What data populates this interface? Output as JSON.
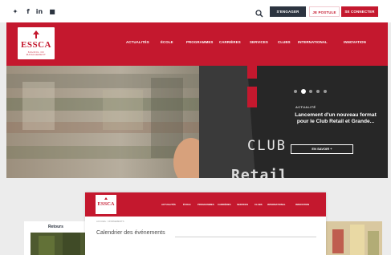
{
  "social": {
    "icons": [
      "twitter-icon",
      "facebook-icon",
      "linkedin-icon",
      "youtube-icon"
    ],
    "glyphs": [
      "🐦",
      "f",
      "in",
      "▶"
    ]
  },
  "utility": {
    "espaces_label": "S'ENGAGER",
    "apply_label": "JE POSTULE",
    "login_label": "SE CONNECTER",
    "search_icon": "search-icon"
  },
  "brand": {
    "logo_text": "ESSCA",
    "logo_subtitle": "SCHOOL OF MANAGEMENT"
  },
  "nav": {
    "items": [
      "ACTUALITÉS",
      "ÉCOLE",
      "PROGRAMMES",
      "CARRIÈRES",
      "SERVICES",
      "CLUBS",
      "INTERNATIONAL",
      "INNOVATION"
    ]
  },
  "hero": {
    "kicker": "ACTUALITÉ",
    "headline": "Lancement d'un nouveau format pour le Club Retail et Grande...",
    "cta": "EN SAVOIR +",
    "sign_text": "CLUB",
    "sign_text2": "Retail",
    "slides_total": 5,
    "slide_active": 2
  },
  "embedded": {
    "logo_text": "ESSCA",
    "breadcrumb": "ACCUEIL > ÉVÉNEMENTS",
    "title": "Calendrier des événements",
    "nav": [
      "ACTUALITÉS",
      "ÉCOLE",
      "PROGRAMMES",
      "CARRIÈRES",
      "SERVICES",
      "CLUBS",
      "INTERNATIONAL",
      "INNOVATION"
    ]
  },
  "side_card": {
    "label": "Retours"
  },
  "colors": {
    "brand_red": "#c4182e",
    "dark": "#2c3440",
    "white": "#ffffff"
  }
}
